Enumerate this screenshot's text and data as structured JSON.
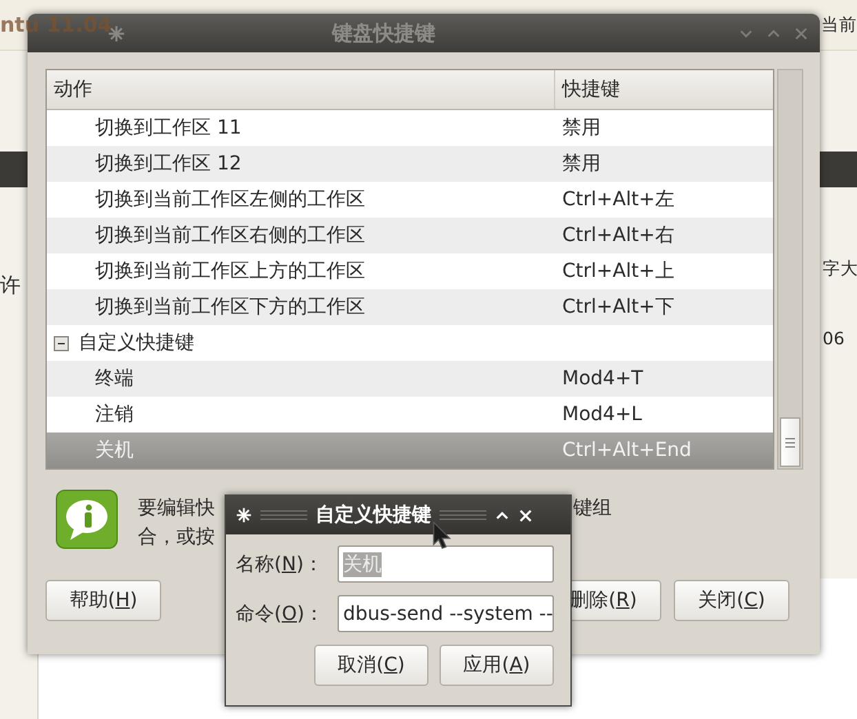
{
  "desktop": {
    "top_left_text": "ntu 11.04",
    "top_right_text": "当前",
    "left_text": "许",
    "right_texts": [
      "字大",
      "06"
    ]
  },
  "main_window": {
    "title": "键盘快捷键",
    "active": false,
    "columns": [
      "动作",
      "快捷键"
    ],
    "sections": [
      {
        "children": [
          {
            "action": "切换到工作区 11",
            "shortcut": "禁用",
            "selected": false
          },
          {
            "action": "切换到工作区 12",
            "shortcut": "禁用",
            "selected": false
          },
          {
            "action": "切换到当前工作区左侧的工作区",
            "shortcut": "Ctrl+Alt+左",
            "selected": false
          },
          {
            "action": "切换到当前工作区右侧的工作区",
            "shortcut": "Ctrl+Alt+右",
            "selected": false
          },
          {
            "action": "切换到当前工作区上方的工作区",
            "shortcut": "Ctrl+Alt+上",
            "selected": false
          },
          {
            "action": "切换到当前工作区下方的工作区",
            "shortcut": "Ctrl+Alt+下",
            "selected": false
          }
        ]
      },
      {
        "label": "自定义快捷键",
        "expanded": true,
        "children": [
          {
            "action": "终端",
            "shortcut": "Mod4+T",
            "selected": false
          },
          {
            "action": "注销",
            "shortcut": "Mod4+L",
            "selected": false
          },
          {
            "action": "关机",
            "shortcut": "Ctrl+Alt+End",
            "selected": true
          }
        ]
      }
    ],
    "info_lines": [
      {
        "before": "要编辑快",
        "after": "键组"
      },
      {
        "before": "合，或按"
      }
    ],
    "left_buttons": [
      {
        "before": "帮助(",
        "key": "H",
        "after": ")"
      }
    ],
    "right_buttons": [
      {
        "before": "删除(",
        "key": "R",
        "after": ")"
      },
      {
        "before": "关闭(",
        "key": "C",
        "after": ")"
      }
    ]
  },
  "dialog": {
    "title": "自定义快捷键",
    "active": true,
    "fields": [
      {
        "before": "名称(",
        "key": "N",
        "after": ")：",
        "value": "关机",
        "value_selected": true
      },
      {
        "before": "命令(",
        "key": "O",
        "after": ")：",
        "value": "dbus-send --system --",
        "value_selected": false
      }
    ],
    "buttons": [
      {
        "before": "取消(",
        "key": "C",
        "after": ")"
      },
      {
        "before": "应用(",
        "key": "A",
        "after": ")"
      }
    ]
  }
}
